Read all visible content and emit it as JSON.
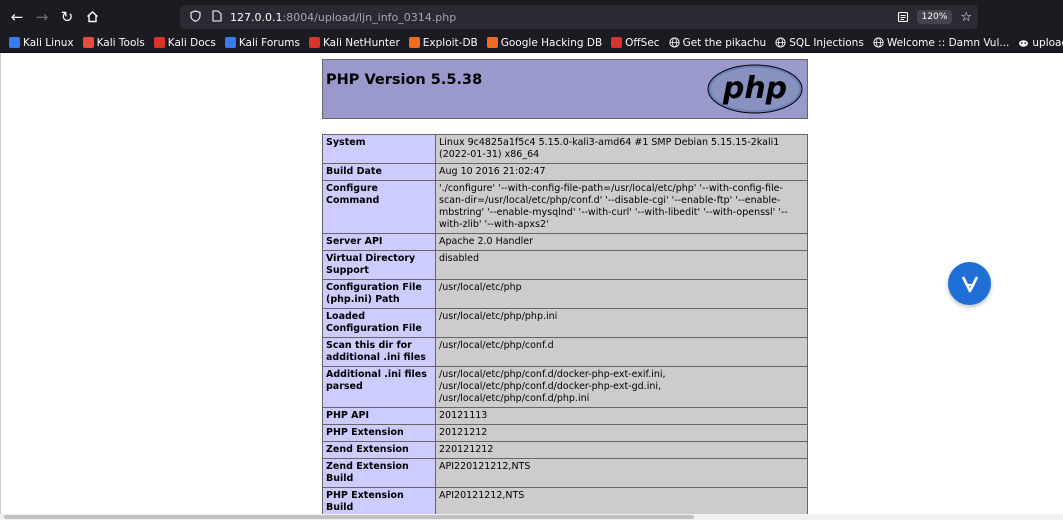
{
  "browser": {
    "url_host": "127.0.0.1",
    "url_rest": ":8004/upload/ljn_info_0314.php",
    "zoom": "120%"
  },
  "bookmarks": [
    {
      "label": "Kali Linux",
      "icon": "kali-icon",
      "color": "#367bf0"
    },
    {
      "label": "Kali Tools",
      "icon": "kali-tools-icon",
      "color": "#e74c3c"
    },
    {
      "label": "Kali Docs",
      "icon": "kali-docs-icon",
      "color": "#d9342b"
    },
    {
      "label": "Kali Forums",
      "icon": "kali-forums-icon",
      "color": "#367bf0"
    },
    {
      "label": "Kali NetHunter",
      "icon": "nethunter-icon",
      "color": "#d9342b"
    },
    {
      "label": "Exploit-DB",
      "icon": "exploitdb-icon",
      "color": "#f26b21"
    },
    {
      "label": "Google Hacking DB",
      "icon": "ghdb-icon",
      "color": "#f26b21"
    },
    {
      "label": "OffSec",
      "icon": "offsec-icon",
      "color": "#d9342b"
    },
    {
      "label": "Get the pikachu",
      "icon": "globe-icon",
      "color": "#fbfbfe"
    },
    {
      "label": "SQL Injections",
      "icon": "globe-icon",
      "color": "#fbfbfe"
    },
    {
      "label": "Welcome :: Damn Vul...",
      "icon": "globe-icon",
      "color": "#fbfbfe"
    },
    {
      "label": "upload-labs",
      "icon": "upload-labs-icon",
      "color": "#fbfbfe"
    }
  ],
  "php": {
    "title": "PHP Version 5.5.38",
    "logo_text": "php",
    "rows": [
      {
        "key": "System",
        "value": "Linux 9c4825a1f5c4 5.15.0-kali3-amd64 #1 SMP Debian 5.15.15-2kali1 (2022-01-31) x86_64"
      },
      {
        "key": "Build Date",
        "value": "Aug 10 2016 21:02:47"
      },
      {
        "key": "Configure Command",
        "value": "'./configure' '--with-config-file-path=/usr/local/etc/php' '--with-config-file-scan-dir=/usr/local/etc/php/conf.d' '--disable-cgi' '--enable-ftp' '--enable-mbstring' '--enable-mysqlnd' '--with-curl' '--with-libedit' '--with-openssl' '--with-zlib' '--with-apxs2'"
      },
      {
        "key": "Server API",
        "value": "Apache 2.0 Handler"
      },
      {
        "key": "Virtual Directory Support",
        "value": "disabled"
      },
      {
        "key": "Configuration File (php.ini) Path",
        "value": "/usr/local/etc/php"
      },
      {
        "key": "Loaded Configuration File",
        "value": "/usr/local/etc/php/php.ini"
      },
      {
        "key": "Scan this dir for additional .ini files",
        "value": "/usr/local/etc/php/conf.d"
      },
      {
        "key": "Additional .ini files parsed",
        "value": "/usr/local/etc/php/conf.d/docker-php-ext-exif.ini, /usr/local/etc/php/conf.d/docker-php-ext-gd.ini, /usr/local/etc/php/conf.d/php.ini"
      },
      {
        "key": "PHP API",
        "value": "20121113"
      },
      {
        "key": "PHP Extension",
        "value": "20121212"
      },
      {
        "key": "Zend Extension",
        "value": "220121212"
      },
      {
        "key": "Zend Extension Build",
        "value": "API220121212,NTS"
      },
      {
        "key": "PHP Extension Build",
        "value": "API20121212,NTS"
      }
    ]
  },
  "colors": {
    "header_bg": "#9999cc",
    "key_bg": "#ccccff",
    "value_bg": "#cccccc",
    "fab_bg": "#1f6fd6"
  }
}
